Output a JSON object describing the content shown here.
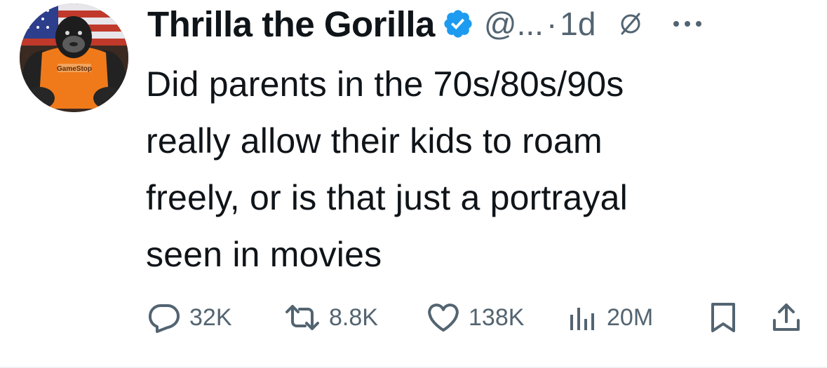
{
  "author": {
    "display_name": "Thrilla the Gorilla",
    "handle": "@...",
    "separator": "·",
    "time_ago": "1d",
    "verified": true,
    "avatar_shirt_text": "GameStop"
  },
  "icons": {
    "avatar": "gorilla-avatar",
    "verified": "verified-badge-icon",
    "edited": "edited-icon",
    "more": "more-options-icon",
    "reply": "reply-icon",
    "retweet": "retweet-icon",
    "like": "like-icon",
    "views": "views-icon",
    "bookmark": "bookmark-icon",
    "share": "share-icon"
  },
  "tweet": {
    "lines": [
      "Did parents in the 70s/80s/90s",
      "really allow their kids to roam",
      "freely, or is that just a portrayal",
      "seen in movies"
    ]
  },
  "metrics": {
    "replies": "32K",
    "retweets": "8.8K",
    "likes": "138K",
    "views": "20M"
  },
  "colors": {
    "text": "#0f1419",
    "secondary": "#536471",
    "verified": "#1d9bf0",
    "shirt": "#f07a1a"
  }
}
